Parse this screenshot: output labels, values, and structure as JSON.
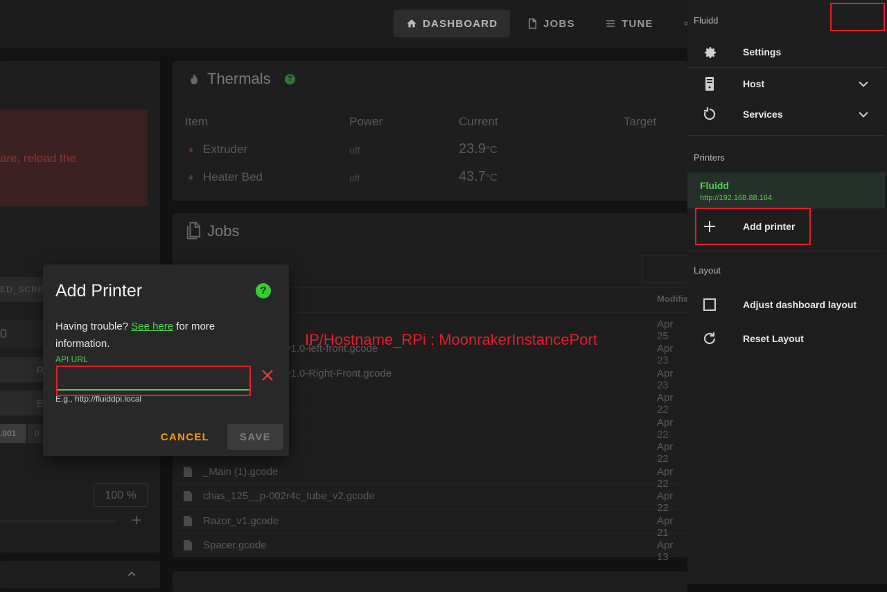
{
  "nav": {
    "dashboard": "DASHBOARD",
    "jobs": "JOBS",
    "tune": "TUNE"
  },
  "left_panel": {
    "warning_text": "are, reload the",
    "screw_label": "ED_SCRE",
    "input_fragment": "0",
    "btn_r": "R",
    "btn_e": "E",
    "step_value": ".001",
    "step_value2": "0",
    "percent": "100 %"
  },
  "thermals": {
    "title": "Thermals",
    "headers": [
      "Item",
      "Power",
      "Current",
      "Target"
    ],
    "rows": [
      {
        "name": "Extruder",
        "power": "off",
        "current": "23.9",
        "unit": "°C",
        "color": "#c0392b"
      },
      {
        "name": "Heater Bed",
        "power": "off",
        "current": "43.7",
        "unit": "°C",
        "color": "#2e86c1"
      }
    ]
  },
  "jobs": {
    "title": "Jobs",
    "modified_header": "Modifie",
    "files": [
      {
        "name": "",
        "date": "Apr 25"
      },
      {
        "name": "s_v1.0-left-front.gcode",
        "date": "Apr 23"
      },
      {
        "name": "s_v1.0-Right-Front.gcode",
        "date": "Apr 23"
      },
      {
        "name": "",
        "date": "Apr 22"
      },
      {
        "name": "",
        "date": "Apr 22"
      },
      {
        "name": "",
        "date": "Apr 22"
      },
      {
        "name": "_Main (1).gcode",
        "date": "Apr 22"
      },
      {
        "name": "chas_125__p-002r4c_tube_v2.gcode",
        "date": "Apr 22"
      },
      {
        "name": "Razor_v1.gcode",
        "date": "Apr 21"
      },
      {
        "name": "Spacer.gcode",
        "date": "Apr 13"
      }
    ]
  },
  "dialog": {
    "title": "Add Printer",
    "help_glyph": "?",
    "text_before_link": "Having trouble? ",
    "link_text": "See here",
    "text_after_link": " for more information.",
    "api_label": "API URL",
    "api_value": "",
    "api_hint": "E.g., http://fluiddpi.local",
    "cancel": "CANCEL",
    "save": "SAVE"
  },
  "annotation": {
    "text": "IP/Hostname_RPi : MoonrakerInstancePort",
    "color": "#e0202a"
  },
  "drawer": {
    "app_name": "Fluidd",
    "items": [
      {
        "label": "Settings",
        "icon": "gear-icon"
      },
      {
        "label": "Host",
        "icon": "server-icon"
      },
      {
        "label": "Services",
        "icon": "restart-icon"
      }
    ],
    "printers_header": "Printers",
    "active_printer": {
      "name": "Fluidd",
      "url": "http://192.168.88.164"
    },
    "add_printer": "Add printer",
    "layout_header": "Layout",
    "adjust_layout": "Adjust dashboard layout",
    "reset_layout": "Reset Layout"
  },
  "colors": {
    "accent_green": "#4cd64c",
    "cancel_orange": "#ff9800"
  }
}
